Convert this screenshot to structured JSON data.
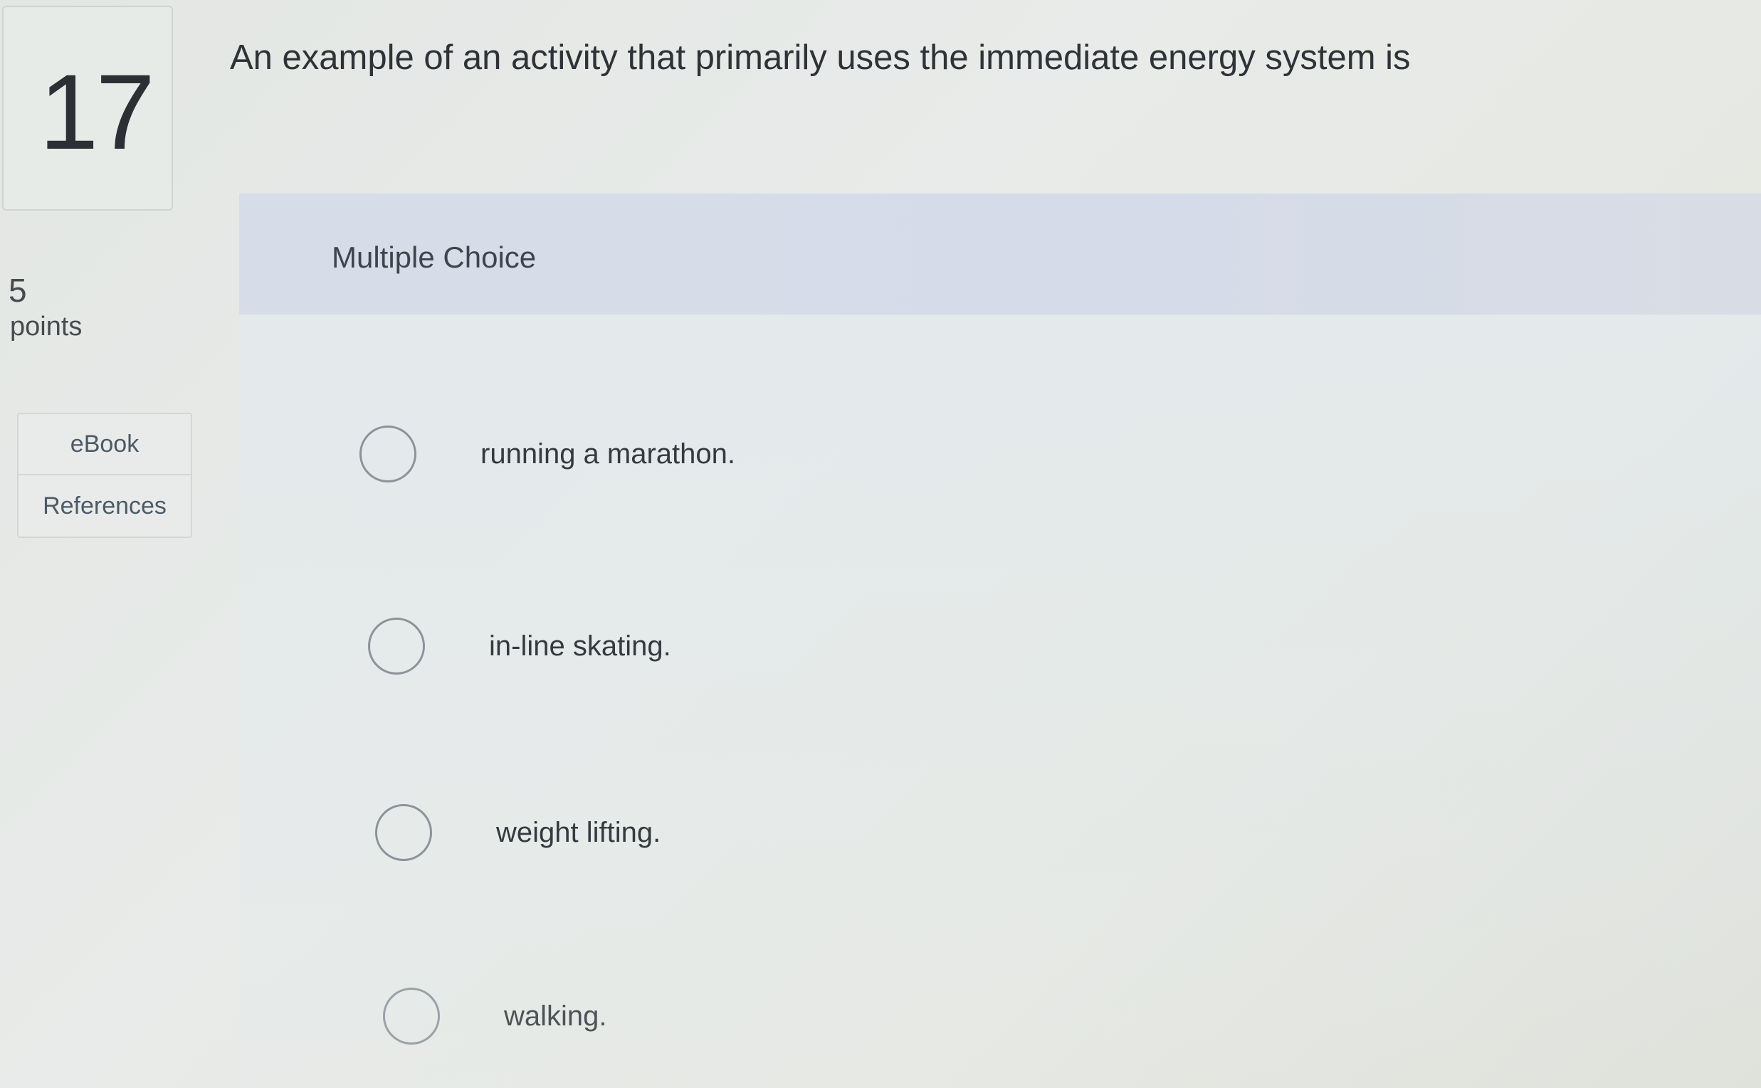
{
  "question": {
    "number": "17",
    "points_value": "5",
    "points_label": "points",
    "text": "An example of an activity that primarily uses the immediate energy system is"
  },
  "sidebar": {
    "links": [
      {
        "label": "eBook"
      },
      {
        "label": "References"
      }
    ]
  },
  "answer_section": {
    "type_label": "Multiple Choice",
    "options": [
      {
        "label": "running a marathon.",
        "selected": false
      },
      {
        "label": "in-line skating.",
        "selected": false
      },
      {
        "label": "weight lifting.",
        "selected": false
      },
      {
        "label": "walking.",
        "selected": false
      }
    ]
  }
}
